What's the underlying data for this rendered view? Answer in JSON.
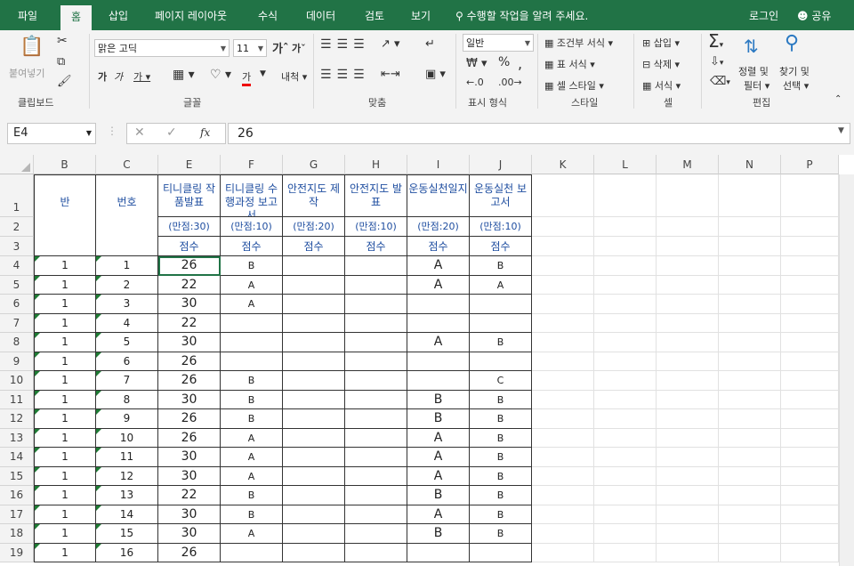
{
  "tabs": [
    "파일",
    "홈",
    "삽입",
    "페이지 레이아웃",
    "수식",
    "데이터",
    "검토",
    "보기"
  ],
  "tell_me": "수행할 작업을 알려 주세요.",
  "login": "로그인",
  "share": "공유",
  "ribbon": {
    "clipboard": {
      "paste": "붙여넣기",
      "label": "클립보드"
    },
    "font": {
      "name": "맑은 고딕",
      "size": "11",
      "label": "글꼴"
    },
    "align": {
      "label": "맞춤"
    },
    "number": {
      "format": "일반",
      "label": "표시 형식"
    },
    "styles": {
      "cond": "조건부 서식",
      "table": "표 서식",
      "cell": "셀 스타일",
      "label": "스타일"
    },
    "cells": {
      "insert": "삽입",
      "delete": "삭제",
      "format": "서식",
      "label": "셀"
    },
    "edit": {
      "sort": "정렬 및",
      "filter": "필터",
      "find": "찾기 및",
      "select": "선택",
      "label": "편집"
    }
  },
  "namebox": "E4",
  "formula": "26",
  "columns": [
    "B",
    "C",
    "E",
    "F",
    "G",
    "H",
    "I",
    "J",
    "K",
    "L",
    "M",
    "N",
    "P"
  ],
  "headers": {
    "ban": "반",
    "num": "번호",
    "e1": "티니클링 작품발표",
    "f1": "티니클링 수행과정 보고서",
    "g1": "안전지도 제작",
    "h1": "안전지도 발표",
    "i1": "운동실천일지",
    "j1": "운동실천 보고서",
    "e2": "(만점:30)",
    "f2": "(만점:10)",
    "g2": "(만점:20)",
    "h2": "(만점:10)",
    "i2": "(만점:20)",
    "j2": "(만점:10)",
    "score": "점수"
  },
  "rows": [
    {
      "r": "4",
      "b": "1",
      "c": "1",
      "e": "26",
      "f": "B",
      "g": "",
      "h": "",
      "i": "A",
      "j": "B"
    },
    {
      "r": "5",
      "b": "1",
      "c": "2",
      "e": "22",
      "f": "A",
      "g": "",
      "h": "",
      "i": "A",
      "j": "A"
    },
    {
      "r": "6",
      "b": "1",
      "c": "3",
      "e": "30",
      "f": "A",
      "g": "",
      "h": "",
      "i": "",
      "j": ""
    },
    {
      "r": "7",
      "b": "1",
      "c": "4",
      "e": "22",
      "f": "",
      "g": "",
      "h": "",
      "i": "",
      "j": ""
    },
    {
      "r": "8",
      "b": "1",
      "c": "5",
      "e": "30",
      "f": "",
      "g": "",
      "h": "",
      "i": "A",
      "j": "B"
    },
    {
      "r": "9",
      "b": "1",
      "c": "6",
      "e": "26",
      "f": "",
      "g": "",
      "h": "",
      "i": "",
      "j": ""
    },
    {
      "r": "10",
      "b": "1",
      "c": "7",
      "e": "26",
      "f": "B",
      "g": "",
      "h": "",
      "i": "",
      "j": "C"
    },
    {
      "r": "11",
      "b": "1",
      "c": "8",
      "e": "30",
      "f": "B",
      "g": "",
      "h": "",
      "i": "B",
      "j": "B"
    },
    {
      "r": "12",
      "b": "1",
      "c": "9",
      "e": "26",
      "f": "B",
      "g": "",
      "h": "",
      "i": "B",
      "j": "B"
    },
    {
      "r": "13",
      "b": "1",
      "c": "10",
      "e": "26",
      "f": "A",
      "g": "",
      "h": "",
      "i": "A",
      "j": "B"
    },
    {
      "r": "14",
      "b": "1",
      "c": "11",
      "e": "30",
      "f": "A",
      "g": "",
      "h": "",
      "i": "A",
      "j": "B"
    },
    {
      "r": "15",
      "b": "1",
      "c": "12",
      "e": "30",
      "f": "A",
      "g": "",
      "h": "",
      "i": "A",
      "j": "B"
    },
    {
      "r": "16",
      "b": "1",
      "c": "13",
      "e": "22",
      "f": "B",
      "g": "",
      "h": "",
      "i": "B",
      "j": "B"
    },
    {
      "r": "17",
      "b": "1",
      "c": "14",
      "e": "30",
      "f": "B",
      "g": "",
      "h": "",
      "i": "A",
      "j": "B"
    },
    {
      "r": "18",
      "b": "1",
      "c": "15",
      "e": "30",
      "f": "A",
      "g": "",
      "h": "",
      "i": "B",
      "j": "B"
    },
    {
      "r": "19",
      "b": "1",
      "c": "16",
      "e": "26",
      "f": "",
      "g": "",
      "h": "",
      "i": "",
      "j": ""
    }
  ],
  "colors": {
    "accent": "#217346"
  }
}
